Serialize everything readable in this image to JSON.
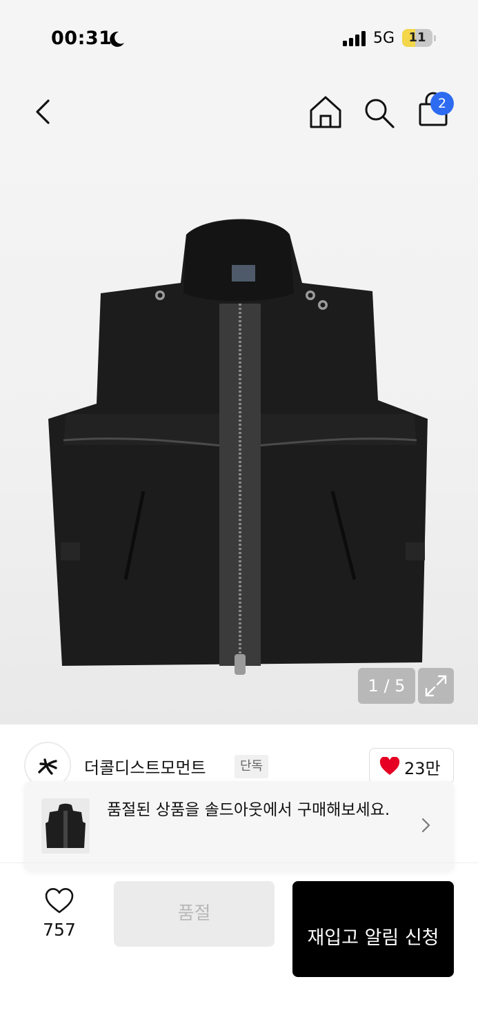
{
  "status_bar": {
    "time": "00:31",
    "network": "5G",
    "battery": "11",
    "icons": [
      "moon-icon",
      "signal-icon"
    ]
  },
  "header": {
    "cart_badge": "2",
    "icons": [
      "back-chevron-icon",
      "home-icon",
      "search-icon",
      "shopping-bag-icon"
    ]
  },
  "gallery": {
    "counter": "1 / 5",
    "icons": [
      "expand-icon"
    ]
  },
  "brand": {
    "name": "더콜디스트모먼트",
    "tag": "단독",
    "likes": "23만",
    "icons": [
      "brand-logo-icon",
      "heart-filled-icon"
    ],
    "heart_color": "#e60023"
  },
  "soldout_banner": {
    "text": "품절된 상품을 솔드아웃에서 구매해보세요.",
    "icons": [
      "chevron-right-icon"
    ]
  },
  "bottom_bar": {
    "wish_count": "757",
    "soldout_label": "품절",
    "restock_label": "재입고 알림 신청",
    "icons": [
      "heart-outline-icon"
    ]
  },
  "colors": {
    "badge": "#2d6bf0",
    "primary_button": "#000000",
    "disabled_button": "#ebebeb"
  }
}
